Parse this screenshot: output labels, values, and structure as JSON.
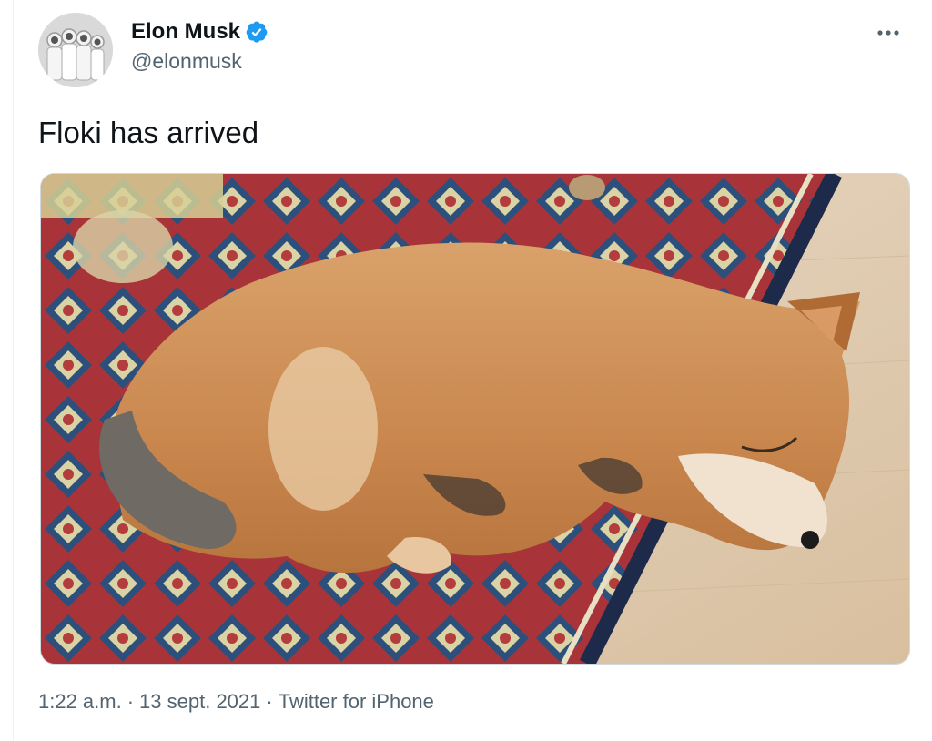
{
  "tweet": {
    "author": {
      "display_name": "Elon Musk",
      "handle": "@elonmusk",
      "verified": true,
      "avatar_icon": "astronauts-avatar"
    },
    "more_icon": "more-horizontal-icon",
    "text": "Floki has arrived",
    "media": {
      "kind": "photo",
      "icon": "sleeping-puppy-photo"
    },
    "meta": {
      "time": "1:22 a.m.",
      "separator": "·",
      "date": "13 sept. 2021",
      "source": "Twitter for iPhone"
    }
  },
  "colors": {
    "text_primary": "#0f1419",
    "text_secondary": "#536471",
    "verified_blue": "#1d9bf0",
    "border": "#cfd9de"
  }
}
